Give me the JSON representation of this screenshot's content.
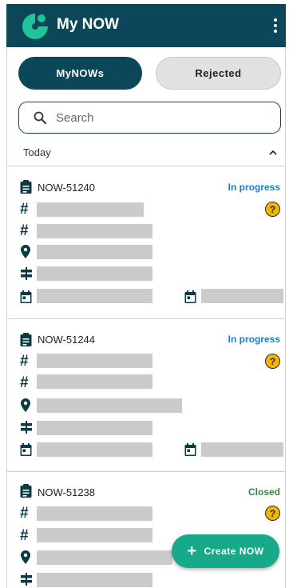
{
  "app": {
    "title": "My NOW"
  },
  "tabs": [
    {
      "label": "MyNOWs",
      "active": true
    },
    {
      "label": "Rejected",
      "active": false
    }
  ],
  "search": {
    "placeholder": "Search",
    "value": ""
  },
  "section": {
    "label": "Today",
    "expanded": true
  },
  "cards": [
    {
      "id": "NOW-51240",
      "status": "In progress",
      "status_color": "#1a7fc1"
    },
    {
      "id": "NOW-51244",
      "status": "In progress",
      "status_color": "#1a7fc1"
    },
    {
      "id": "NOW-51238",
      "status": "Closed",
      "status_color": "#2e8b3d"
    }
  ],
  "fab": {
    "label": "Create NOW",
    "icon": "plus-icon"
  },
  "colors": {
    "primary": "#0b4759",
    "accent": "#16a98a",
    "warning": "#f4b400"
  }
}
